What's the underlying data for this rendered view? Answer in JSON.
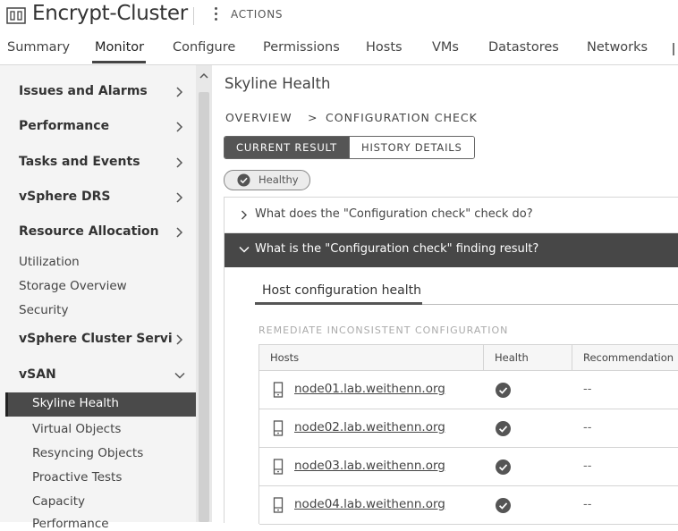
{
  "header": {
    "title": "Encrypt-Cluster",
    "actions_label": "ACTIONS"
  },
  "tabs": [
    {
      "label": "Summary",
      "active": false
    },
    {
      "label": "Monitor",
      "active": true
    },
    {
      "label": "Configure",
      "active": false
    },
    {
      "label": "Permissions",
      "active": false
    },
    {
      "label": "Hosts",
      "active": false
    },
    {
      "label": "VMs",
      "active": false
    },
    {
      "label": "Datastores",
      "active": false
    },
    {
      "label": "Networks",
      "active": false
    }
  ],
  "sidebar": {
    "sections": [
      {
        "label": "Issues and Alarms",
        "expanded": false
      },
      {
        "label": "Performance",
        "expanded": false
      },
      {
        "label": "Tasks and Events",
        "expanded": false
      },
      {
        "label": "vSphere DRS",
        "expanded": false
      },
      {
        "label": "Resource Allocation",
        "expanded": false
      }
    ],
    "items": [
      {
        "label": "Utilization"
      },
      {
        "label": "Storage Overview"
      },
      {
        "label": "Security"
      }
    ],
    "cluster_services": {
      "label": "vSphere Cluster Services",
      "expanded": false
    },
    "vsan": {
      "label": "vSAN",
      "expanded": true,
      "items": [
        {
          "label": "Skyline Health",
          "selected": true
        },
        {
          "label": "Virtual Objects"
        },
        {
          "label": "Resyncing Objects"
        },
        {
          "label": "Proactive Tests"
        },
        {
          "label": "Capacity"
        },
        {
          "label": "Performance"
        }
      ]
    }
  },
  "main": {
    "title": "Skyline Health",
    "breadcrumb": {
      "overview": "OVERVIEW",
      "separator": ">",
      "current": "CONFIGURATION CHECK"
    },
    "segment": {
      "current": "CURRENT RESULT",
      "history": "HISTORY DETAILS"
    },
    "status_badge": "Healthy",
    "accordion": [
      {
        "label": "What does the \"Configuration check\" check do?",
        "expanded": false
      },
      {
        "label": "What is the \"Configuration check\" finding result?",
        "expanded": true
      }
    ],
    "subtab": "Host configuration health",
    "section_label": "REMEDIATE INCONSISTENT CONFIGURATION",
    "table": {
      "columns": [
        "Hosts",
        "Health",
        "Recommendation"
      ],
      "rows": [
        {
          "host": "node01.lab.weithenn.org",
          "health": "healthy",
          "recommendation": "--"
        },
        {
          "host": "node02.lab.weithenn.org",
          "health": "healthy",
          "recommendation": "--"
        },
        {
          "host": "node03.lab.weithenn.org",
          "health": "healthy",
          "recommendation": "--"
        },
        {
          "host": "node04.lab.weithenn.org",
          "health": "healthy",
          "recommendation": "--"
        }
      ]
    }
  },
  "colors": {
    "selected_nav_bg": "#4a4a4a",
    "expanded_accordion_bg": "#474747",
    "sidebar_bg": "#f4f4f4",
    "healthy_icon": "#555555"
  },
  "icons": {
    "cluster": "cluster-icon",
    "actions": "kebab-icon",
    "nav_expand": "chevron-right-icon",
    "nav_collapse": "chevron-down-icon",
    "badge": "check-circle-icon",
    "host": "host-icon",
    "health": "check-circle-icon"
  }
}
